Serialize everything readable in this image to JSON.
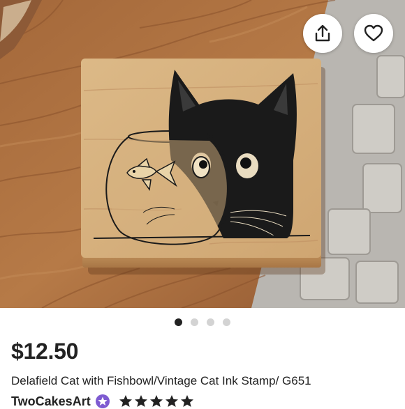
{
  "product": {
    "price": "$12.50",
    "title": "Delafield Cat with Fishbowl/Vintage Cat Ink Stamp/ G651",
    "image_count": 4,
    "active_image": 1
  },
  "shop": {
    "name": "TwoCakesArt",
    "rating": 5,
    "badge_icon": "star-seller-badge-icon"
  },
  "actions": {
    "share_icon": "share-icon",
    "favorite_icon": "heart-icon"
  },
  "colors": {
    "badge": "#7e5bd1",
    "text": "#222222",
    "dot_active": "#222222",
    "dot_inactive": "#d3d3d3"
  }
}
